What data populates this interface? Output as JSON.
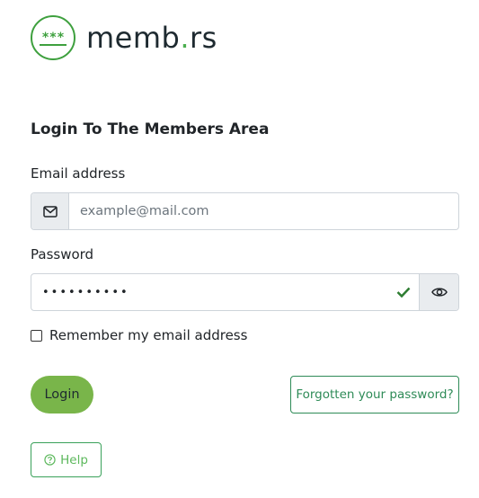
{
  "brand": {
    "name_main": "memb",
    "name_dot": ".",
    "name_tld": "rs",
    "badge_text": "***",
    "brand_color": "#3ea03e"
  },
  "form": {
    "heading": "Login To The Members Area",
    "email": {
      "label": "Email address",
      "placeholder": "example@mail.com",
      "value": "",
      "icon": "envelope-icon"
    },
    "password": {
      "label": "Password",
      "value": "••••••••••",
      "valid_icon": "check-icon",
      "toggle_icon": "eye-icon"
    },
    "remember": {
      "label": "Remember my email address",
      "checked": false
    },
    "login_label": "Login",
    "forgot_label": "Forgotten your password?",
    "help_label": "Help",
    "help_icon": "question-circle-icon"
  },
  "colors": {
    "login_bg": "#79b54a",
    "outline_green": "#2e8b57",
    "check_green": "#2e7d32"
  }
}
